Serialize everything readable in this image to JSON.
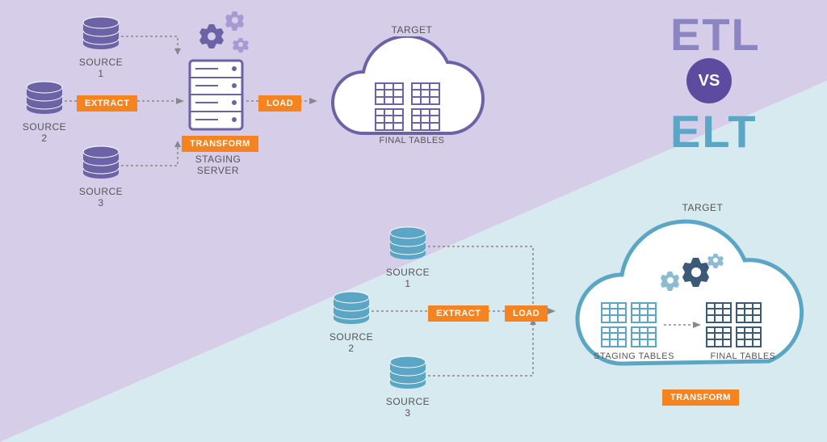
{
  "title": {
    "etl": "ETL",
    "vs": "VS",
    "elt": "ELT"
  },
  "etl": {
    "sources": [
      "SOURCE 1",
      "SOURCE 2",
      "SOURCE 3"
    ],
    "extract": "EXTRACT",
    "transform": "TRANSFORM",
    "staging": "STAGING\nSERVER",
    "load": "LOAD",
    "target": "TARGET",
    "final": "FINAL TABLES"
  },
  "elt": {
    "sources": [
      "SOURCE 1",
      "SOURCE 2",
      "SOURCE 3"
    ],
    "extract": "EXTRACT",
    "load": "LOAD",
    "target": "TARGET",
    "staging": "STAGING TABLES",
    "final": "FINAL TABLES",
    "transform": "TRANSFORM"
  },
  "colors": {
    "purple": "#6c63a6",
    "blue": "#5aa6c4",
    "orange": "#f58320"
  }
}
